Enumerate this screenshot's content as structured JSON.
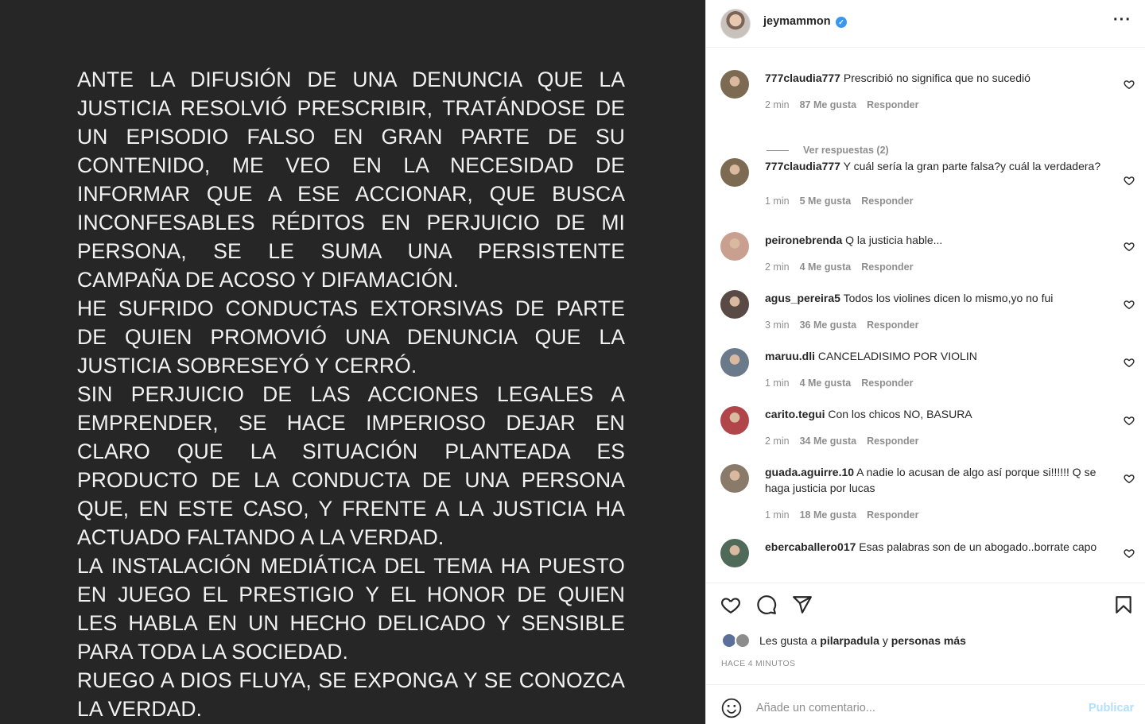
{
  "post": {
    "paragraphs": [
      "ANTE LA DIFUSIÓN DE UNA DENUNCIA QUE LA JUSTICIA RESOLVIÓ PRESCRIBIR, TRATÁNDOSE  DE UN EPISODIO FALSO EN GRAN PARTE DE SU CONTENIDO, ME VEO EN LA NECESIDAD DE INFORMAR QUE A ESE ACCIONAR, QUE BUSCA INCONFESABLES RÉDITOS EN PERJUICIO DE MI PERSONA, SE LE SUMA UNA PERSISTENTE CAMPAÑA DE ACOSO Y DIFAMACIÓN.",
      "HE SUFRIDO CONDUCTAS EXTORSIVAS DE PARTE DE QUIEN PROMOVIÓ UNA DENUNCIA QUE LA JUSTICIA SOBRESEYÓ Y CERRÓ.",
      "SIN PERJUICIO DE LAS ACCIONES LEGALES A EMPRENDER, SE HACE IMPERIOSO DEJAR EN CLARO QUE LA SITUACIÓN PLANTEADA ES PRODUCTO DE LA CONDUCTA DE UNA PERSONA QUE, EN ESTE CASO, Y FRENTE A LA JUSTICIA HA ACTUADO FALTANDO A LA VERDAD.",
      "LA INSTALACIÓN MEDIÁTICA DEL TEMA HA PUESTO EN JUEGO EL PRESTIGIO Y EL HONOR DE QUIEN LES HABLA EN UN HECHO DELICADO Y SENSIBLE PARA TODA LA SOCIEDAD.",
      "RUEGO A DIOS FLUYA, SE EXPONGA Y SE CONOZCA LA VERDAD."
    ]
  },
  "header": {
    "username": "jeymammon",
    "verified_icon": "verified-badge-icon",
    "more_icon": "more-options-icon"
  },
  "comments": [
    {
      "user": "777claudia777",
      "text": "Prescribió no significa que no sucedió",
      "time": "2 min",
      "likes": "87 Me gusta",
      "reply": "Responder",
      "view_replies": "Ver respuestas (2)",
      "avatar_color": "#7d6a52"
    },
    {
      "user": "777claudia777",
      "text": "Y cuál sería la gran parte falsa?y cuál la verdadera?",
      "time": "1 min",
      "likes": "5 Me gusta",
      "reply": "Responder",
      "avatar_color": "#7d6a52"
    },
    {
      "user": "peironebrenda",
      "text": "Q la justicia hable...",
      "time": "2 min",
      "likes": "4 Me gusta",
      "reply": "Responder",
      "avatar_color": "#c9a08f"
    },
    {
      "user": "agus_pereira5",
      "text": "Todos los violines dicen lo mismo,yo no fui",
      "time": "3 min",
      "likes": "36 Me gusta",
      "reply": "Responder",
      "avatar_color": "#5a4a45"
    },
    {
      "user": "maruu.dli",
      "text": "CANCELADISIMO POR VIOLIN",
      "time": "1 min",
      "likes": "4 Me gusta",
      "reply": "Responder",
      "avatar_color": "#6b7a8a"
    },
    {
      "user": "carito.tegui",
      "text": "Con los chicos NO, BASURA",
      "time": "2 min",
      "likes": "34 Me gusta",
      "reply": "Responder",
      "avatar_color": "#b0464a"
    },
    {
      "user": "guada.aguirre.10",
      "text": "A nadie lo acusan de algo así porque si!!!!!! Q se haga justicia por lucas",
      "time": "1 min",
      "likes": "18 Me gusta",
      "reply": "Responder",
      "avatar_color": "#8a7a6a"
    },
    {
      "user": "ebercaballero017",
      "text": "Esas palabras son de un abogado..borrate capo",
      "time": "",
      "likes": "",
      "reply": "",
      "avatar_color": "#4f6a58"
    }
  ],
  "actions": {
    "like_icon": "heart-icon",
    "comment_icon": "comment-icon",
    "share_icon": "share-icon",
    "save_icon": "bookmark-icon",
    "likes_prefix": "Les gusta a",
    "likes_user": "pilarpadula",
    "likes_middle": "y",
    "likes_suffix": "personas más",
    "time_ago": "HACE 4 MINUTOS"
  },
  "add_comment": {
    "emoji_icon": "emoji-icon",
    "placeholder": "Añade un comentario...",
    "publish_label": "Publicar"
  }
}
